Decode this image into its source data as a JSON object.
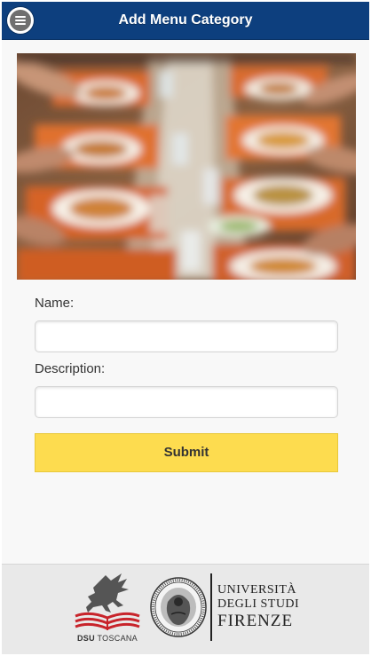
{
  "header": {
    "title": "Add Menu Category",
    "menu_icon": "hamburger-menu-icon",
    "color": "#0d3f7e"
  },
  "banner": {
    "icon": "dining-photo"
  },
  "form": {
    "name_label": "Name:",
    "name_value": "",
    "description_label": "Description:",
    "description_value": "",
    "submit_label": "Submit",
    "submit_color": "#fddc4f"
  },
  "footer": {
    "dsu_brand": "DSU",
    "dsu_region": "TOSCANA",
    "university_line1": "UNIVERSITÀ",
    "university_line2": "DEGLI STUDI",
    "university_line3": "FIRENZE"
  }
}
